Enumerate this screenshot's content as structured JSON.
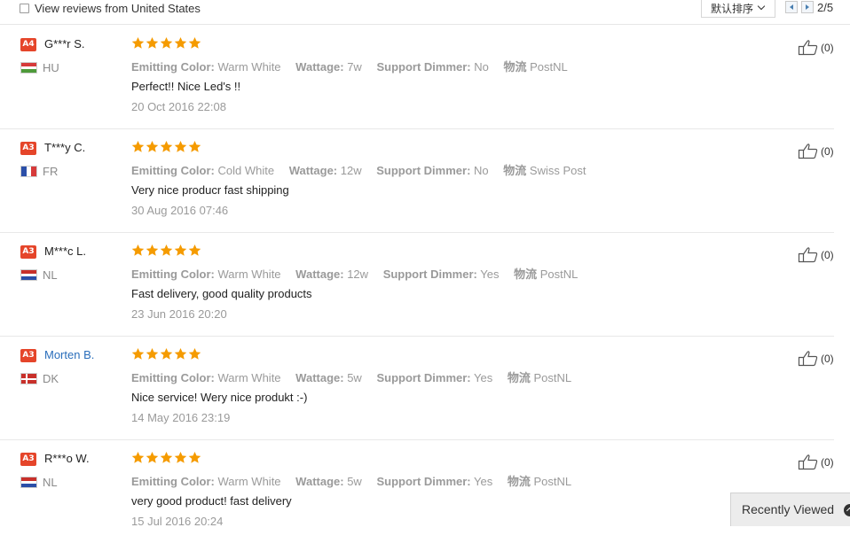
{
  "filter": {
    "label": "View reviews from United States"
  },
  "sort": {
    "selected": "默认排序"
  },
  "pagination": {
    "indicator": "2/5"
  },
  "reviews": [
    {
      "level": "A4",
      "name": "G***r S.",
      "country": "HU",
      "rating": 5,
      "attributes": [
        {
          "key": "Emitting Color:",
          "value": "Warm White"
        },
        {
          "key": "Wattage:",
          "value": "7w"
        },
        {
          "key": "Support Dimmer:",
          "value": "No"
        },
        {
          "key": "物流",
          "value": "PostNL"
        }
      ],
      "feedback": "Perfect!! Nice Led's !!",
      "date": "20 Oct 2016 22:08",
      "helpful": "(0)"
    },
    {
      "level": "A3",
      "name": "T***y C.",
      "country": "FR",
      "rating": 5,
      "attributes": [
        {
          "key": "Emitting Color:",
          "value": "Cold White"
        },
        {
          "key": "Wattage:",
          "value": "12w"
        },
        {
          "key": "Support Dimmer:",
          "value": "No"
        },
        {
          "key": "物流",
          "value": "Swiss Post"
        }
      ],
      "feedback": "Very nice producr fast shipping",
      "date": "30 Aug 2016 07:46",
      "helpful": "(0)"
    },
    {
      "level": "A3",
      "name": "M***c L.",
      "country": "NL",
      "rating": 5,
      "attributes": [
        {
          "key": "Emitting Color:",
          "value": "Warm White"
        },
        {
          "key": "Wattage:",
          "value": "12w"
        },
        {
          "key": "Support Dimmer:",
          "value": "Yes"
        },
        {
          "key": "物流",
          "value": "PostNL"
        }
      ],
      "feedback": "Fast delivery, good quality products",
      "date": "23 Jun 2016 20:20",
      "helpful": "(0)"
    },
    {
      "level": "A3",
      "name": "Morten B.",
      "country": "DK",
      "rating": 5,
      "attributes": [
        {
          "key": "Emitting Color:",
          "value": "Warm White"
        },
        {
          "key": "Wattage:",
          "value": "5w"
        },
        {
          "key": "Support Dimmer:",
          "value": "Yes"
        },
        {
          "key": "物流",
          "value": "PostNL"
        }
      ],
      "feedback": "Nice service! Wery nice produkt :-)",
      "date": "14 May 2016 23:19",
      "helpful": "(0)"
    },
    {
      "level": "A3",
      "name": "R***o W.",
      "country": "NL",
      "rating": 5,
      "attributes": [
        {
          "key": "Emitting Color:",
          "value": "Warm White"
        },
        {
          "key": "Wattage:",
          "value": "5w"
        },
        {
          "key": "Support Dimmer:",
          "value": "Yes"
        },
        {
          "key": "物流",
          "value": "PostNL"
        }
      ],
      "feedback": "very good product! fast delivery",
      "date": "15 Jul 2016 20:24",
      "helpful": "(0)"
    }
  ],
  "recently_viewed": {
    "label": "Recently Viewed"
  },
  "colors": {
    "badge": "#e5452a",
    "star": "#f59b00",
    "link": "#2a6ebb"
  },
  "icons": {
    "star": "star-icon",
    "thumb": "thumbs-up-icon",
    "prev": "chevron-left-icon",
    "next": "chevron-right-icon"
  }
}
